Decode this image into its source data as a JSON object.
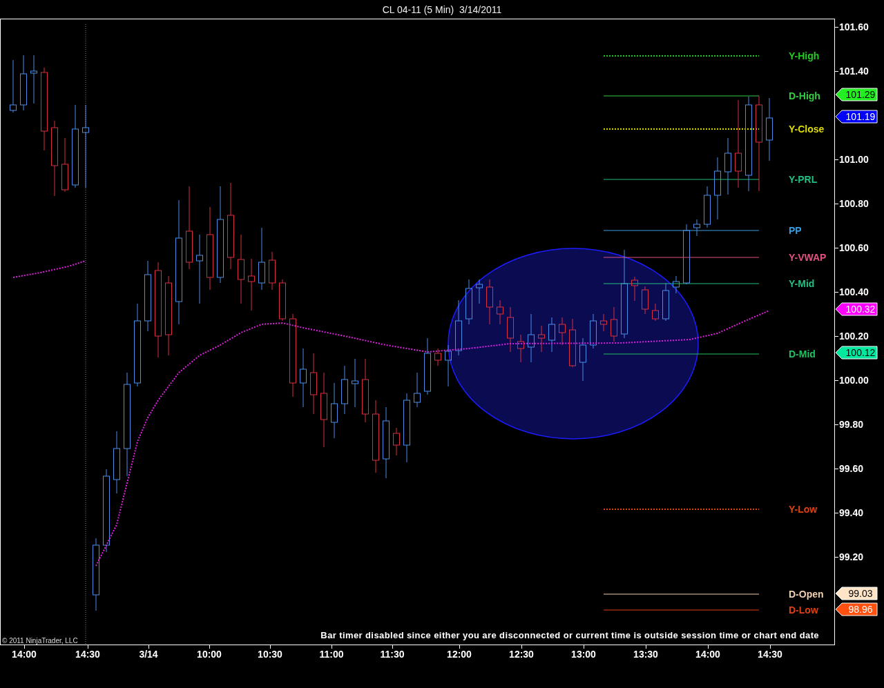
{
  "window": {
    "title": "CL 04-11 (5 Min)  3/14/2011"
  },
  "levels": [
    {
      "label": "Y-High",
      "kind": "dotted",
      "color": "#22cc22"
    },
    {
      "label": "D-High",
      "kind": "solid",
      "color": "#33cc44"
    },
    {
      "label": "Y-Close",
      "kind": "dotted",
      "color": "#dddd00"
    },
    {
      "label": "Y-PRL",
      "kind": "solid",
      "color": "#20c080"
    },
    {
      "label": "PP",
      "kind": "solid",
      "color": "#3a9ee0"
    },
    {
      "label": "Y-VWAP",
      "kind": "solid",
      "color": "#e05080"
    },
    {
      "label": "Y-Mid",
      "kind": "solid",
      "color": "#20c080"
    },
    {
      "label": "D-Mid",
      "kind": "solid",
      "color": "#22c060"
    },
    {
      "label": "Y-Low",
      "kind": "dotted",
      "color": "#e04010"
    },
    {
      "label": "D-Open",
      "kind": "solid",
      "color": "#f0d0b0"
    },
    {
      "label": "D-Low",
      "kind": "solid",
      "color": "#e04010"
    }
  ],
  "price_axis": {
    "ticks": [
      "101.60",
      "101.40",
      "101.00",
      "100.80",
      "100.60",
      "100.40",
      "100.20",
      "100.00",
      "99.80",
      "99.60",
      "99.40",
      "99.20"
    ],
    "badges": [
      {
        "value": "101.29",
        "color": "#22ee22"
      },
      {
        "value": "101.19",
        "color": "#0000ff"
      },
      {
        "value": "100.32",
        "color": "#ff00ff"
      },
      {
        "value": "100.12",
        "color": "#00e8a0"
      },
      {
        "value": "99.03",
        "color": "#ffe4c8"
      },
      {
        "value": "98.96",
        "color": "#ff5010"
      }
    ]
  },
  "time_axis": {
    "ticks": [
      "14:00",
      "14:30",
      "3/14",
      "10:00",
      "10:30",
      "11:00",
      "11:30",
      "12:00",
      "12:30",
      "13:00",
      "13:30",
      "14:00",
      "14:30"
    ]
  },
  "copyright": "© 2011 NinjaTrader, LLC",
  "status_message": "Bar timer disabled since either you are disconnected or current time is outside session time or chart end date"
}
